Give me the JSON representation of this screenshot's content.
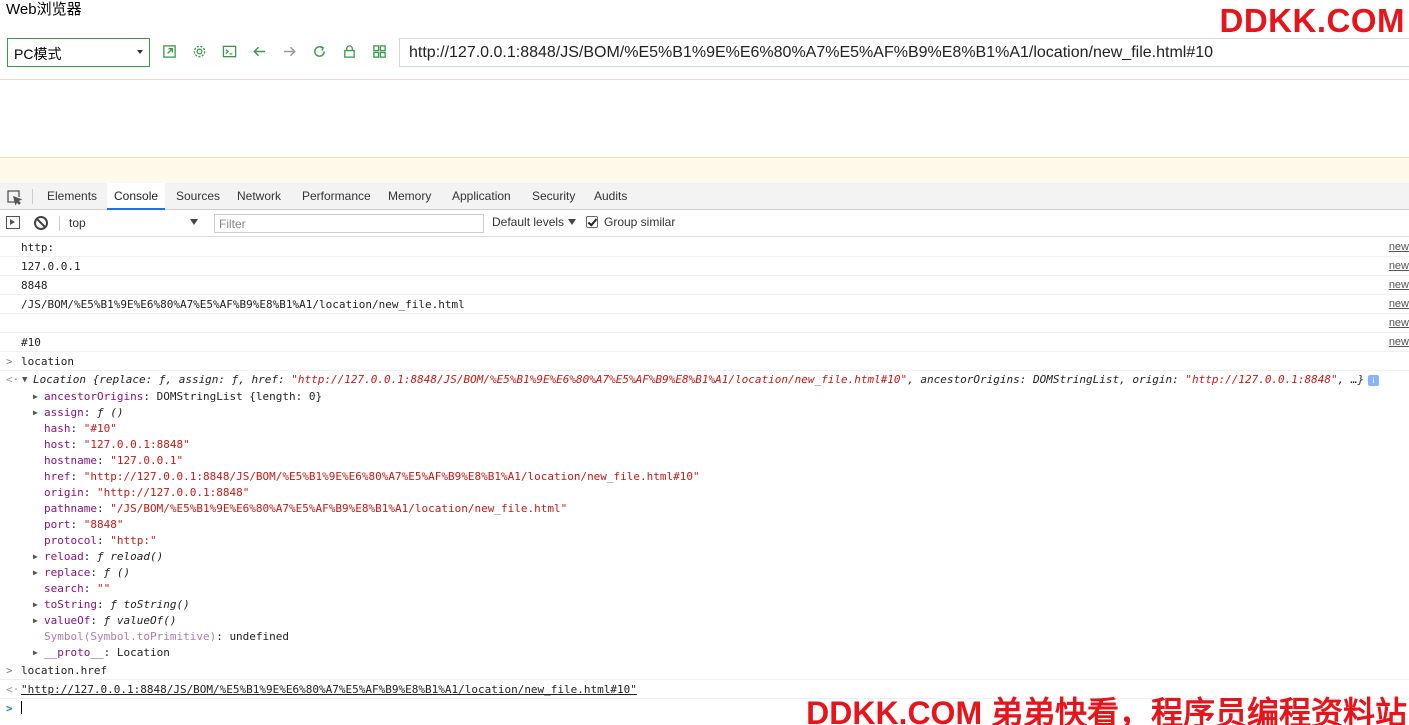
{
  "window": {
    "title": "Web浏览器",
    "brand": "DDKK.COM"
  },
  "toolbar": {
    "mode_label": "PC模式",
    "url": "http://127.0.0.1:8848/JS/BOM/%E5%B1%9E%E6%80%A7%E5%AF%B9%E8%B1%A1/location/new_file.html#10"
  },
  "devtools": {
    "tabs": [
      "Elements",
      "Console",
      "Sources",
      "Network",
      "Performance",
      "Memory",
      "Application",
      "Security",
      "Audits"
    ],
    "active_tab": "Console"
  },
  "console_bar": {
    "context": "top",
    "filter_placeholder": "Filter",
    "levels": "Default levels",
    "group_similar": "Group similar"
  },
  "logs": [
    {
      "text": "http:",
      "src": "new"
    },
    {
      "text": "127.0.0.1",
      "src": "new"
    },
    {
      "text": "8848",
      "src": "new"
    },
    {
      "text": "/JS/BOM/%E5%B1%9E%E6%80%A7%E5%AF%B9%E8%B1%A1/location/new_file.html",
      "src": "new"
    },
    {
      "text": "",
      "src": "new"
    },
    {
      "text": "#10",
      "src": "new"
    }
  ],
  "cmd1": "location",
  "location_obj": {
    "head_prefix": "Location {replace: ƒ, assign: ƒ, href: ",
    "head_href": "\"http://127.0.0.1:8848/JS/BOM/%E5%B1%9E%E6%80%A7%E5%AF%B9%E8%B1%A1/location/new_file.html#10\"",
    "head_mid": ", ancestorOrigins: DOMStringList, origin: ",
    "head_origin": "\"http://127.0.0.1:8848\"",
    "head_suffix": ", …}",
    "info": "i",
    "props": [
      {
        "key": "ancestorOrigins",
        "value": "DOMStringList {length: 0}",
        "kind": "plain",
        "expand": true
      },
      {
        "key": "assign",
        "value": "ƒ ()",
        "kind": "fn",
        "expand": true
      },
      {
        "key": "hash",
        "value": "\"#10\"",
        "kind": "str",
        "expand": false
      },
      {
        "key": "host",
        "value": "\"127.0.0.1:8848\"",
        "kind": "str",
        "expand": false
      },
      {
        "key": "hostname",
        "value": "\"127.0.0.1\"",
        "kind": "str",
        "expand": false
      },
      {
        "key": "href",
        "value": "\"http://127.0.0.1:8848/JS/BOM/%E5%B1%9E%E6%80%A7%E5%AF%B9%E8%B1%A1/location/new_file.html#10\"",
        "kind": "str",
        "expand": false
      },
      {
        "key": "origin",
        "value": "\"http://127.0.0.1:8848\"",
        "kind": "str",
        "expand": false
      },
      {
        "key": "pathname",
        "value": "\"/JS/BOM/%E5%B1%9E%E6%80%A7%E5%AF%B9%E8%B1%A1/location/new_file.html\"",
        "kind": "str",
        "expand": false
      },
      {
        "key": "port",
        "value": "\"8848\"",
        "kind": "str",
        "expand": false
      },
      {
        "key": "protocol",
        "value": "\"http:\"",
        "kind": "str",
        "expand": false
      },
      {
        "key": "reload",
        "value": "ƒ reload()",
        "kind": "fn",
        "expand": true
      },
      {
        "key": "replace",
        "value": "ƒ ()",
        "kind": "fn",
        "expand": true
      },
      {
        "key": "search",
        "value": "\"\"",
        "kind": "str",
        "expand": false
      },
      {
        "key": "toString",
        "value": "ƒ toString()",
        "kind": "fn",
        "expand": true
      },
      {
        "key": "valueOf",
        "value": "ƒ valueOf()",
        "kind": "fn",
        "expand": true
      },
      {
        "key": "Symbol(Symbol.toPrimitive)",
        "value": "undefined",
        "kind": "plain",
        "expand": false,
        "dim": true
      },
      {
        "key": "__proto__",
        "value": "Location",
        "kind": "plain",
        "expand": true
      }
    ]
  },
  "cmd2": "location.href",
  "result2": "\"http://127.0.0.1:8848/JS/BOM/%E5%B1%9E%E6%80%A7%E5%AF%B9%E8%B1%A1/location/new_file.html#10\"",
  "watermark": "DDKK.COM 弟弟快看，程序员编程资料站",
  "colors": {
    "accent_green": "#3b9a4a",
    "string_red": "#c41a16",
    "key_purple": "#881280",
    "brand_red": "#e8141b",
    "tab_blue": "#1a73e8"
  }
}
